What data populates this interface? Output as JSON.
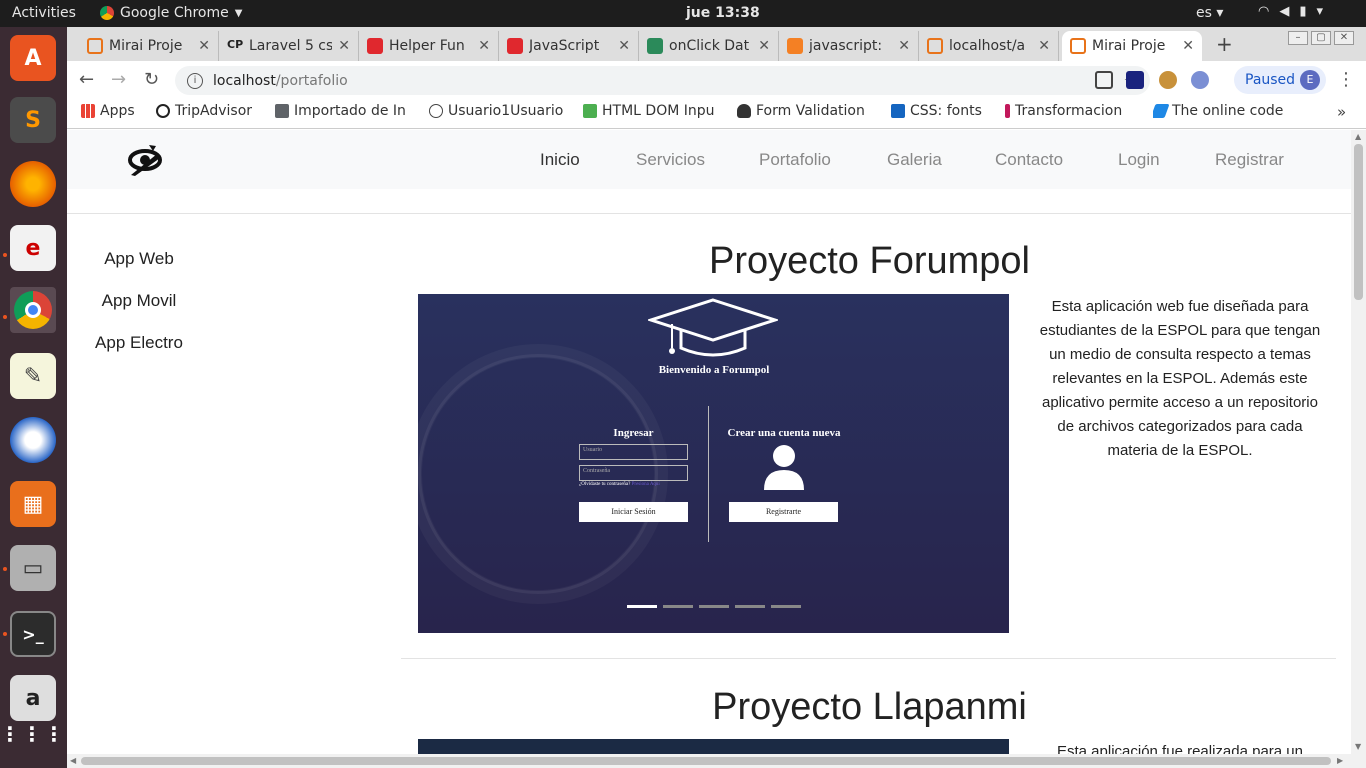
{
  "os": {
    "activities": "Activities",
    "app_name": "Google Chrome",
    "clock": "jue 13:38",
    "lang": "es"
  },
  "tabs": [
    {
      "title": "Mirai Proje",
      "color": "#e8731a"
    },
    {
      "title": "Laravel 5 cs",
      "color": "#222222"
    },
    {
      "title": "Helper Fun",
      "color": "#e0282e"
    },
    {
      "title": "JavaScript",
      "color": "#e0282e"
    },
    {
      "title": "onClick Dat",
      "color": "#2b8a5a"
    },
    {
      "title": "javascript:",
      "color": "#f48024"
    },
    {
      "title": "localhost/a",
      "color": "#e8731a"
    },
    {
      "title": "Mirai Proje",
      "color": "#e8731a"
    }
  ],
  "address": {
    "host": "localhost",
    "path": "/portafolio"
  },
  "profile": {
    "status": "Paused",
    "initial": "E"
  },
  "bookmarks": [
    {
      "label": "Apps",
      "color": "#4285f4"
    },
    {
      "label": "TripAdvisor",
      "color": "#222222"
    },
    {
      "label": "Importado de In",
      "color": "#5f6368"
    },
    {
      "label": "Usuario1Usuario",
      "color": "#444444"
    },
    {
      "label": "HTML DOM Inpu",
      "color": "#4caf50"
    },
    {
      "label": "Form Validation",
      "color": "#333333"
    },
    {
      "label": "CSS: fonts",
      "color": "#1565c0"
    },
    {
      "label": "Transformacion",
      "color": "#c2185b"
    },
    {
      "label": "The online code",
      "color": "#1e88e5"
    }
  ],
  "site": {
    "nav": [
      "Inicio",
      "Servicios",
      "Portafolio",
      "Galeria",
      "Contacto",
      "Login",
      "Registrar"
    ],
    "sidebar": [
      "App Web",
      "App Movil",
      "App Electro"
    ],
    "projects": [
      {
        "title": "Proyecto Forumpol",
        "description": "Esta aplicación web fue diseñada para estudiantes de la ESPOL para que tengan un medio de consulta respecto a temas relevantes en la ESPOL. Además este aplicativo permite acceso a un repositorio de archivos categorizados para cada materia de la ESPOL."
      },
      {
        "title": "Proyecto Llapanmi",
        "description": "Esta aplicación fue realizada para un"
      }
    ],
    "screenshot": {
      "welcome": "Bienvenido a Forumpol",
      "login_title": "Ingresar",
      "user_placeholder": "Usuario",
      "pass_placeholder": "Contraseña",
      "forgot": "¿Olvidaste tu contraseña?",
      "forgot_link": "Presiona Aquí",
      "login_btn": "Iniciar Sesión",
      "signup_title": "Crear una cuenta nueva",
      "signup_btn": "Registrarte"
    }
  }
}
